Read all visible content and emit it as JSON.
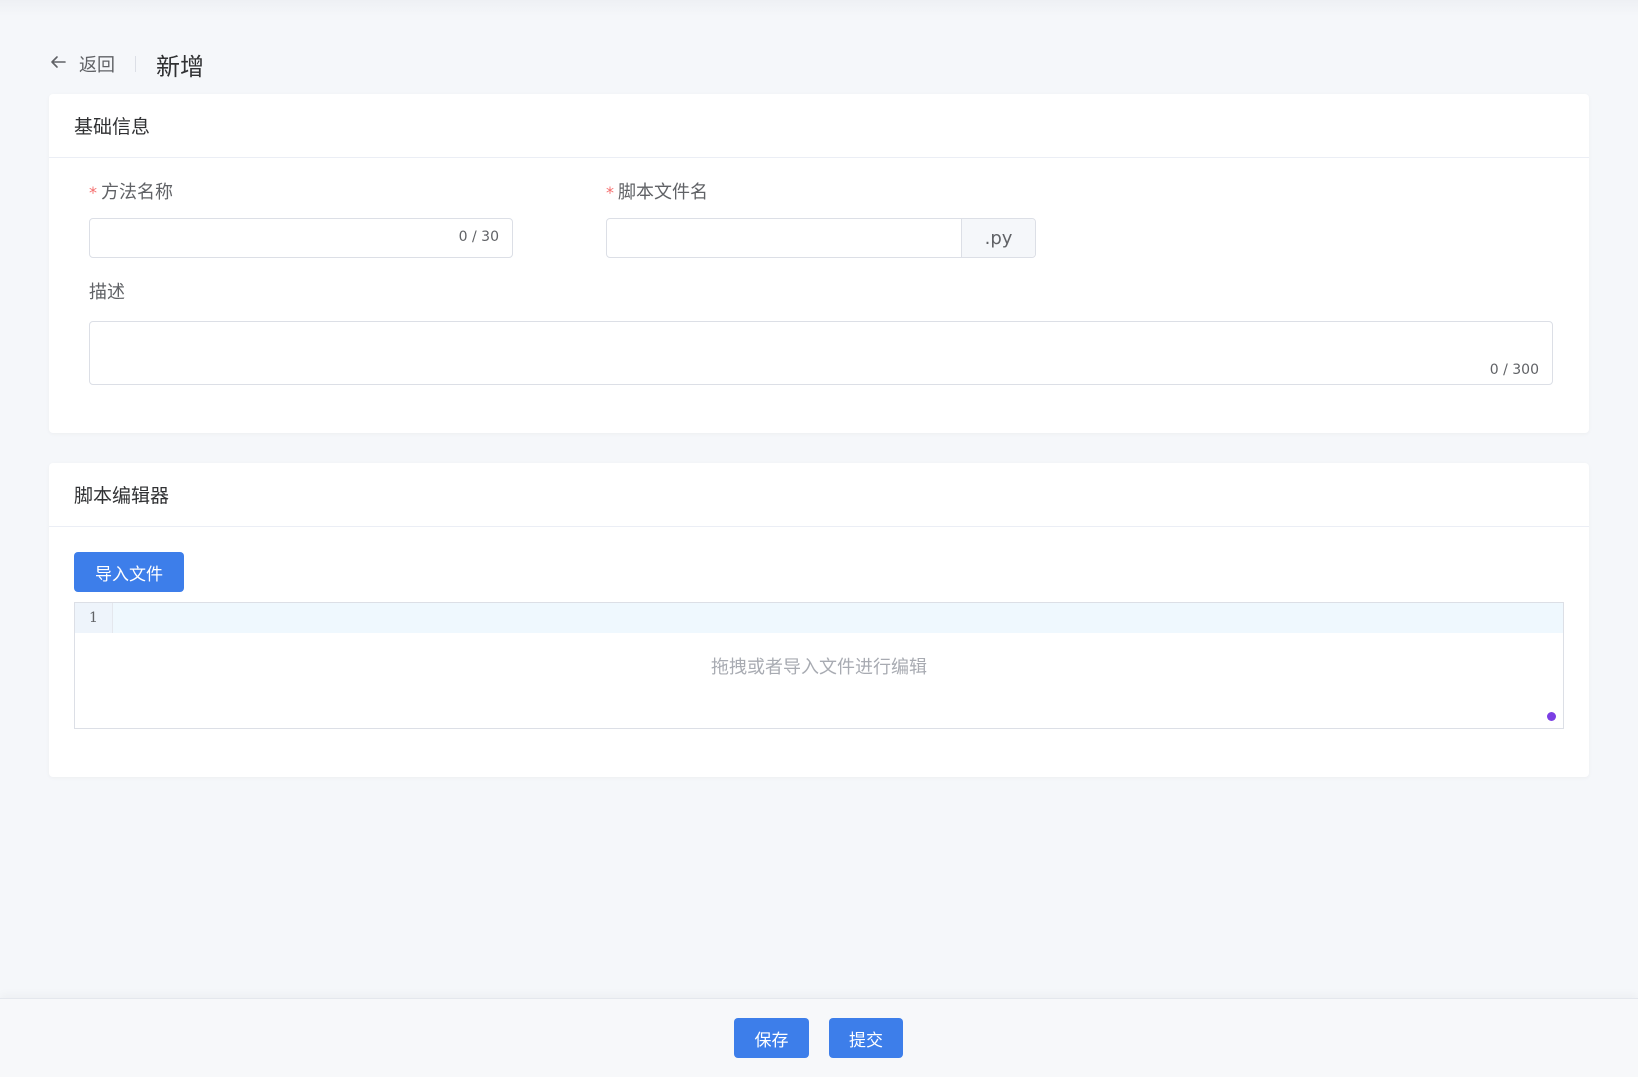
{
  "header": {
    "back_label": "返回",
    "title": "新增"
  },
  "basic_info": {
    "section_title": "基础信息",
    "method_name": {
      "required_mark": "*",
      "label": "方法名称",
      "value": "",
      "counter": "0 / 30"
    },
    "script_filename": {
      "required_mark": "*",
      "label": "脚本文件名",
      "value": "",
      "suffix": ".py"
    },
    "description": {
      "label": "描述",
      "value": "",
      "counter": "0 / 300"
    }
  },
  "script_editor": {
    "section_title": "脚本编辑器",
    "import_button_label": "导入文件",
    "line_number": "1",
    "placeholder": "拖拽或者导入文件进行编辑"
  },
  "footer": {
    "save_label": "保存",
    "submit_label": "提交"
  },
  "colors": {
    "primary": "#3d7eea",
    "required": "#f56c6c",
    "background": "#f5f7fa"
  }
}
